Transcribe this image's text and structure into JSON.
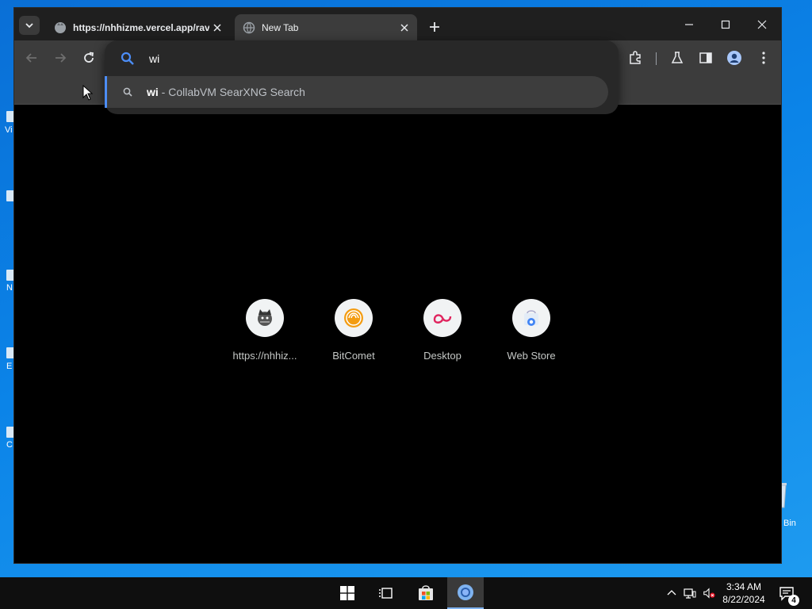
{
  "desktop": {
    "labels": [
      "Vi",
      "N",
      "E",
      "C"
    ],
    "recycle_bin_label": "Bin"
  },
  "browser": {
    "tabs": [
      {
        "title": "https://nhhizme.vercel.app/rav",
        "active": false
      },
      {
        "title": "New Tab",
        "active": true
      }
    ],
    "omnibox": {
      "input_value": "wi",
      "suggestion": {
        "query": "wi",
        "separator": " - ",
        "engine": "CollabVM SearXNG Search"
      }
    },
    "shortcuts": [
      {
        "label": "https://nhhiz...",
        "icon": "cat-icon"
      },
      {
        "label": "BitComet",
        "icon": "bitcomet-icon"
      },
      {
        "label": "Desktop",
        "icon": "desktop-icon"
      },
      {
        "label": "Web Store",
        "icon": "webstore-icon"
      }
    ]
  },
  "taskbar": {
    "time": "3:34 AM",
    "date": "8/22/2024",
    "notification_count": "4"
  },
  "colors": {
    "desktop_bg": "#0b84e8",
    "toolbar_bg": "#3c3c3c",
    "omnibox_bg": "#282828",
    "accent": "#4c8df6"
  }
}
